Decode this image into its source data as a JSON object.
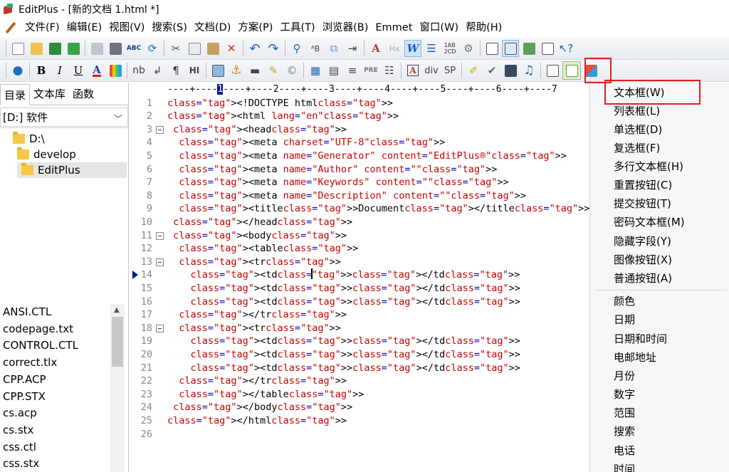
{
  "window": {
    "title": "EditPlus - [新的文档 1.html *]"
  },
  "menu": [
    "文件(F)",
    "编辑(E)",
    "视图(V)",
    "搜索(S)",
    "文档(D)",
    "方案(P)",
    "工具(T)",
    "浏览器(B)",
    "Emmet",
    "窗口(W)",
    "帮助(H)"
  ],
  "toolbar2_text": {
    "bold": "B",
    "italic": "I",
    "underline": "U",
    "font": "A",
    "nb": "nb",
    "br": "↲",
    "para": "¶",
    "hr": "HI",
    "pre": "PRE",
    "div": "div",
    "sp": "SP"
  },
  "left_panel": {
    "tabs": [
      "目录",
      "文本库",
      "函数"
    ],
    "drive": "[D:] 软件",
    "folders": [
      "D:\\",
      "develop",
      "EditPlus"
    ],
    "files": [
      "ANSI.CTL",
      "codepage.txt",
      "CONTROL.CTL",
      "correct.tlx",
      "CPP.ACP",
      "CPP.STX",
      "cs.acp",
      "cs.stx",
      "css.ctl",
      "css.stx"
    ]
  },
  "editor": {
    "ruler": "----+----1----+----2----+----3----+----4----+----5----+----6----+----7",
    "lines": [
      {
        "n": "1",
        "text": "<!DOCTYPE html>"
      },
      {
        "n": "2",
        "text": "<html lang=\"en\">"
      },
      {
        "n": "3",
        "text": " <head>"
      },
      {
        "n": "4",
        "text": "  <meta charset=\"UTF-8\">"
      },
      {
        "n": "5",
        "text": "  <meta name=\"Generator\" content=\"EditPlus®\">"
      },
      {
        "n": "6",
        "text": "  <meta name=\"Author\" content=\"\">"
      },
      {
        "n": "7",
        "text": "  <meta name=\"Keywords\" content=\"\">"
      },
      {
        "n": "8",
        "text": "  <meta name=\"Description\" content=\"\">"
      },
      {
        "n": "9",
        "text": "  <title>Document</title>"
      },
      {
        "n": "10",
        "text": " </head>"
      },
      {
        "n": "11",
        "text": " <body>"
      },
      {
        "n": "12",
        "text": "  <table>"
      },
      {
        "n": "13",
        "text": "  <tr>"
      },
      {
        "n": "14",
        "text": "    <td></td>"
      },
      {
        "n": "15",
        "text": "    <td></td>"
      },
      {
        "n": "16",
        "text": "    <td></td>"
      },
      {
        "n": "17",
        "text": "  </tr>"
      },
      {
        "n": "18",
        "text": "  <tr>"
      },
      {
        "n": "19",
        "text": "    <td></td>"
      },
      {
        "n": "20",
        "text": "    <td></td>"
      },
      {
        "n": "21",
        "text": "    <td></td>"
      },
      {
        "n": "22",
        "text": "  </tr>"
      },
      {
        "n": "23",
        "text": "  </table>"
      },
      {
        "n": "24",
        "text": " </body>"
      },
      {
        "n": "25",
        "text": "</html>"
      },
      {
        "n": "26",
        "text": ""
      }
    ]
  },
  "dropdown": {
    "group1": [
      "文本框(W)",
      "列表框(L)",
      "单选框(D)",
      "复选框(F)",
      "多行文本框(H)",
      "重置按钮(C)",
      "提交按钮(T)",
      "密码文本框(M)",
      "隐藏字段(Y)",
      "图像按钮(X)",
      "普通按钮(A)"
    ],
    "group2": [
      "颜色",
      "日期",
      "日期和时间",
      "电邮地址",
      "月份",
      "数字",
      "范围",
      "搜索",
      "电话",
      "时间"
    ]
  },
  "highlight_color": "#e02020"
}
